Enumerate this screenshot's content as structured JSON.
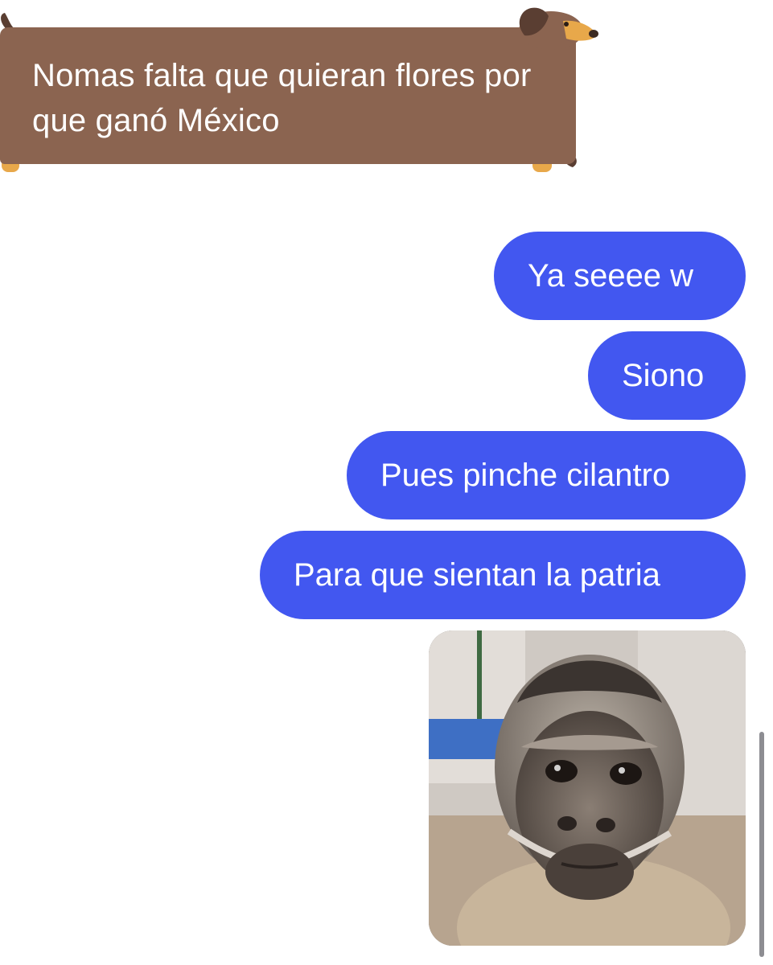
{
  "conversation": {
    "incoming": [
      {
        "text": "Nomas falta que quieran flores por que ganó México",
        "bubble_style": "dachshund-dog"
      }
    ],
    "outgoing": [
      {
        "text": "Ya seeee w"
      },
      {
        "text": "Siono"
      },
      {
        "text": "Pues pinche cilantro"
      },
      {
        "text": "Para que sientan la patria"
      }
    ],
    "attachment": {
      "kind": "image",
      "subject": "sad capuchin monkey"
    }
  },
  "colors": {
    "incoming_bubble": "#8B6450",
    "outgoing_bubble": "#4257F0",
    "outgoing_text": "#FFFFFF",
    "dog_ears": "#5A3E32",
    "dog_paws": "#E8A84A"
  },
  "icons": {
    "dog_head": "dachshund-head-icon",
    "dog_tail": "dachshund-tail-icon"
  }
}
